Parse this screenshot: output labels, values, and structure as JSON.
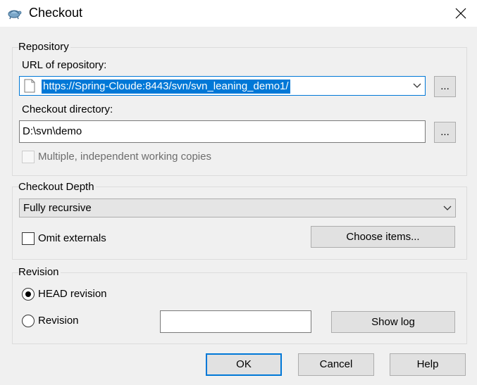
{
  "window": {
    "title": "Checkout",
    "icon": "tortoise-svn-icon",
    "close_icon": "close-icon"
  },
  "repository": {
    "group_label": "Repository",
    "url_label": "URL of repository:",
    "url_value": "https://Spring-Cloude:8443/svn/svn_leaning_demo1/",
    "browse_label": "...",
    "dir_label": "Checkout directory:",
    "dir_value": "D:\\svn\\demo",
    "dir_browse_label": "...",
    "multiple_label": "Multiple, independent working copies",
    "multiple_checked": false,
    "multiple_enabled": false
  },
  "depth": {
    "group_label": "Checkout Depth",
    "selected": "Fully recursive",
    "omit_label": "Omit externals",
    "omit_checked": false,
    "choose_label": "Choose items..."
  },
  "revision": {
    "group_label": "Revision",
    "head_label": "HEAD revision",
    "head_selected": true,
    "rev_label": "Revision",
    "rev_value": "",
    "showlog_label": "Show log"
  },
  "footer": {
    "ok_label": "OK",
    "cancel_label": "Cancel",
    "help_label": "Help"
  },
  "colors": {
    "accent": "#0078d7",
    "dialog_bg": "#f0f0f0",
    "button_bg": "#e1e1e1"
  }
}
